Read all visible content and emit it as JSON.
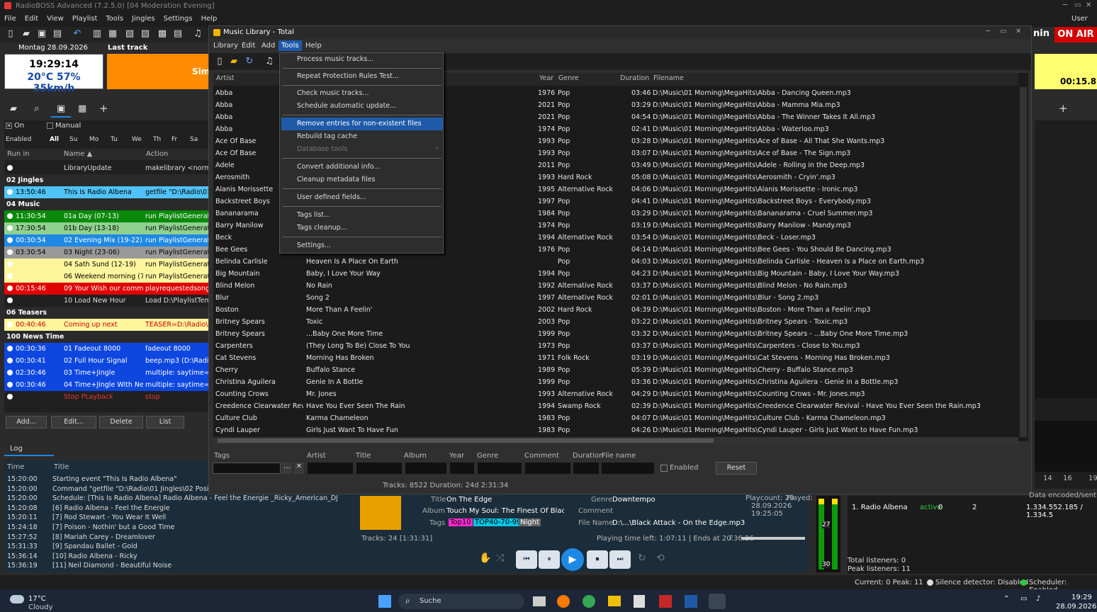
{
  "app": {
    "title": "RadioBOSS Advanced (7.2.5.0) [04 Moderation Evening]",
    "user": "User",
    "onair": "ON AIR",
    "min_label": "nin",
    "countdown": "00:15.8"
  },
  "menu": [
    "File",
    "Edit",
    "View",
    "Playlist",
    "Tools",
    "Jingles",
    "Settings",
    "Help"
  ],
  "header": {
    "date": "Montag 28.09.2026",
    "last_track_label": "Last track",
    "time": "19:29:14",
    "weather": "20°C 57% 35km/h",
    "sim": "Sim"
  },
  "scheduler": {
    "on_label": "On",
    "manual_label": "Manual",
    "days": [
      "Enabled",
      "All",
      "Su",
      "Mo",
      "Tu",
      "We",
      "Th",
      "Fr",
      "Sa"
    ],
    "columns": [
      "Run in",
      "Name ▲",
      "Action"
    ],
    "rows": [
      {
        "time": "",
        "name": "LibraryUpdate",
        "action": "makelibrary <norma",
        "bg": "#202020",
        "fg": "#ddd",
        "group": false
      },
      {
        "time": "",
        "name": "02 Jingles",
        "action": "",
        "bg": "#2a2a2a",
        "fg": "#fff",
        "group": true
      },
      {
        "time": "13:50:46",
        "name": "This Is Radio Albena",
        "action": "getfile \"D:\\Radio\\01",
        "bg": "#4fc3f7",
        "fg": "#000",
        "group": false
      },
      {
        "time": "",
        "name": "04 Music",
        "action": "",
        "bg": "#2a2a2a",
        "fg": "#fff",
        "group": true
      },
      {
        "time": "11:30:54",
        "name": "01a Day (07-13)",
        "action": "run PlaylistGenerato",
        "bg": "#0a8a0a",
        "fg": "#fff",
        "group": false
      },
      {
        "time": "17:30:54",
        "name": "01b Day (13-18)",
        "action": "run PlaylistGenerato",
        "bg": "#8fd18f",
        "fg": "#000",
        "group": false
      },
      {
        "time": "00:30:54",
        "name": "02 Evening Mix (19-22)",
        "action": "run PlaylistGenerato",
        "bg": "#1e88e5",
        "fg": "#fff",
        "group": false
      },
      {
        "time": "03:30:54",
        "name": "03 Night (23-06)",
        "action": "run PlaylistGenerato",
        "bg": "#999999",
        "fg": "#000",
        "group": false
      },
      {
        "time": "",
        "name": "04 Sath Sund (12-19)",
        "action": "run PlaylistGenerato",
        "bg": "#fff59d",
        "fg": "#000",
        "group": false
      },
      {
        "time": "",
        "name": "06 Weekend morning (7...",
        "action": "run PlaylistGenerato",
        "bg": "#fff59d",
        "fg": "#000",
        "group": false
      },
      {
        "time": "00:15:46",
        "name": "09 Your Wish our comm...",
        "action": "playrequestedsong",
        "bg": "#e00000",
        "fg": "#fff",
        "group": false
      },
      {
        "time": "",
        "name": "10 Load New Hour",
        "action": "Load D:\\PlaylistTemp",
        "bg": "#202020",
        "fg": "#ddd",
        "group": false
      },
      {
        "time": "",
        "name": "06 Teasers",
        "action": "",
        "bg": "#2a2a2a",
        "fg": "#fff",
        "group": true
      },
      {
        "time": "00:40:46",
        "name": "Coming up next",
        "action": "TEASER=D:\\Radio\\0",
        "bg": "#fff59d",
        "fg": "#d40000",
        "group": false
      },
      {
        "time": "",
        "name": "100 News Time",
        "action": "",
        "bg": "#2a2a2a",
        "fg": "#fff",
        "group": true
      },
      {
        "time": "00:30:36",
        "name": "01 Fadeout 8000",
        "action": "fadeout 8000",
        "bg": "#0d47e0",
        "fg": "#fff",
        "group": false
      },
      {
        "time": "00:30:41",
        "name": "02 Full Hour Signal",
        "action": "beep.mp3 (D:\\Radio\\",
        "bg": "#0d47e0",
        "fg": "#fff",
        "group": false
      },
      {
        "time": "02:30:46",
        "name": "03 Time+Jingle",
        "action": "multiple: saytime=D",
        "bg": "#0d47e0",
        "fg": "#fff",
        "group": false
      },
      {
        "time": "00:30:46",
        "name": "04 Time+Jingle With Ne...",
        "action": "multiple: saytime=D",
        "bg": "#0d47e0",
        "fg": "#fff",
        "group": false
      },
      {
        "time": "",
        "name": "Stop PLayback",
        "action": "stop",
        "bg": "#202020",
        "fg": "#e53935",
        "group": false
      }
    ],
    "buttons": [
      "Add...",
      "Edit...",
      "Delete",
      "List"
    ]
  },
  "log": {
    "tab": "Log",
    "columns": [
      "Time",
      "Title"
    ],
    "rows": [
      [
        "15:20:00",
        "Starting event \"This Is Radio Albena\""
      ],
      [
        "15:20:00",
        "Command \"getfile \"D:\\Radio\\01 Jingles\\02 Position"
      ],
      [
        "15:20:00",
        "Schedule: [This Is Radio Albena] Radio Albena - Feel the Energie _Ricky_American_DJ.mp3 (..."
      ],
      [
        "15:20:08",
        "[6]  Radio Albena - Feel the Energie"
      ],
      [
        "15:20:11",
        "[7]  Rod Stewart - You Wear It Well"
      ],
      [
        "15:24:18",
        "[7]  Poison - Nothin' but a Good Time"
      ],
      [
        "15:27:52",
        "[8]  Mariah Carey - Dreamlover"
      ],
      [
        "15:31:33",
        "[9]  Spandau Ballet - Gold"
      ],
      [
        "15:36:14",
        "[10]  Radio Albena - Ricky"
      ],
      [
        "15:36:19",
        "[11]  Neil Diamond - Beautiful Noise"
      ]
    ]
  },
  "library": {
    "title": "Music Library - Total",
    "menu": [
      "Library",
      "Edit",
      "Add",
      "Tools",
      "Help"
    ],
    "columns": [
      "Artist",
      "Year",
      "Genre",
      "Duration",
      "Filename"
    ],
    "rows": [
      [
        "Abba",
        "",
        "1976",
        "Pop",
        "03:46",
        "D:\\Music\\01 Morning\\MegaHits\\Abba - Dancing Queen.mp3"
      ],
      [
        "Abba",
        "",
        "2021",
        "Pop",
        "03:29",
        "D:\\Music\\01 Morning\\MegaHits\\Abba - Mamma Mia.mp3"
      ],
      [
        "Abba",
        "",
        "2021",
        "Pop",
        "04:54",
        "D:\\Music\\01 Morning\\MegaHits\\Abba - The Winner Takes It All.mp3"
      ],
      [
        "Abba",
        "",
        "1974",
        "Pop",
        "02:41",
        "D:\\Music\\01 Morning\\MegaHits\\Abba - Waterloo.mp3"
      ],
      [
        "Ace Of Base",
        "",
        "1993",
        "Pop",
        "03:28",
        "D:\\Music\\01 Morning\\MegaHits\\Ace of Base - All That She Wants.mp3"
      ],
      [
        "Ace Of Base",
        "",
        "1993",
        "Pop",
        "03:07",
        "D:\\Music\\01 Morning\\MegaHits\\Ace of Base - The Sign.mp3"
      ],
      [
        "Adele",
        "",
        "2011",
        "Pop",
        "03:49",
        "D:\\Music\\01 Morning\\MegaHits\\Adele - Rolling in the Deep.mp3"
      ],
      [
        "Aerosmith",
        "",
        "1993",
        "Hard Rock",
        "05:08",
        "D:\\Music\\01 Morning\\MegaHits\\Aerosmith - Cryin'.mp3"
      ],
      [
        "Alanis Morissette",
        "",
        "1995",
        "Alternative Rock",
        "04:06",
        "D:\\Music\\01 Morning\\MegaHits\\Alanis Morissette - Ironic.mp3"
      ],
      [
        "Backstreet Boys",
        "on)",
        "1997",
        "Pop",
        "04:41",
        "D:\\Music\\01 Morning\\MegaHits\\Backstreet Boys - Everybody.mp3"
      ],
      [
        "Bananarama",
        "",
        "1984",
        "Pop",
        "03:29",
        "D:\\Music\\01 Morning\\MegaHits\\Bananarama - Cruel Summer.mp3"
      ],
      [
        "Barry Manilow",
        "",
        "1974",
        "Pop",
        "03:19",
        "D:\\Music\\01 Morning\\MegaHits\\Barry Manilow - Mandy.mp3"
      ],
      [
        "Beck",
        "",
        "1994",
        "Alternative Rock",
        "03:54",
        "D:\\Music\\01 Morning\\MegaHits\\Beck - Loser.mp3"
      ],
      [
        "Bee Gees",
        "",
        "1976",
        "Pop",
        "04:14",
        "D:\\Music\\01 Morning\\MegaHits\\Bee Gees - You Should Be Dancing.mp3"
      ],
      [
        "Belinda Carlisle",
        "Heaven Is A Place On Earth",
        "",
        "Pop",
        "04:03",
        "D:\\Music\\01 Morning\\MegaHits\\Belinda Carlisle - Heaven Is a Place on Earth.mp3"
      ],
      [
        "Big Mountain",
        "Baby, I Love Your Way",
        "1994",
        "Pop",
        "04:23",
        "D:\\Music\\01 Morning\\MegaHits\\Big Mountain - Baby, I Love Your Way.mp3"
      ],
      [
        "Blind Melon",
        "No Rain",
        "1992",
        "Alternative Rock",
        "03:37",
        "D:\\Music\\01 Morning\\MegaHits\\Blind Melon - No Rain.mp3"
      ],
      [
        "Blur",
        "Song 2",
        "1997",
        "Alternative Rock",
        "02:01",
        "D:\\Music\\01 Morning\\MegaHits\\Blur - Song 2.mp3"
      ],
      [
        "Boston",
        "More Than A Feelin'",
        "2002",
        "Hard Rock",
        "04:39",
        "D:\\Music\\01 Morning\\MegaHits\\Boston - More Than a Feelin'.mp3"
      ],
      [
        "Britney Spears",
        "Toxic",
        "2003",
        "Pop",
        "03:22",
        "D:\\Music\\01 Morning\\MegaHits\\Britney Spears - Toxic.mp3"
      ],
      [
        "Britney Spears",
        "...Baby One More Time",
        "1999",
        "Pop",
        "03:32",
        "D:\\Music\\01 Morning\\MegaHits\\Britney Spears - ...Baby One More Time.mp3"
      ],
      [
        "Carpenters",
        "(They Long To Be) Close To You",
        "1973",
        "Pop",
        "03:37",
        "D:\\Music\\01 Morning\\MegaHits\\Carpenters - Close to You.mp3"
      ],
      [
        "Cat Stevens",
        "Morning Has Broken",
        "1971",
        "Folk Rock",
        "03:19",
        "D:\\Music\\01 Morning\\MegaHits\\Cat Stevens - Morning Has Broken.mp3"
      ],
      [
        "Cherry",
        "Buffalo Stance",
        "1989",
        "Pop",
        "05:39",
        "D:\\Music\\01 Morning\\MegaHits\\Cherry - Buffalo Stance.mp3"
      ],
      [
        "Christina Aguilera",
        "Genie In A Bottle",
        "1999",
        "Pop",
        "03:36",
        "D:\\Music\\01 Morning\\MegaHits\\Christina Aguilera - Genie in a Bottle.mp3"
      ],
      [
        "Counting Crows",
        "Mr. Jones",
        "1993",
        "Alternative Rock",
        "04:29",
        "D:\\Music\\01 Morning\\MegaHits\\Counting Crows - Mr. Jones.mp3"
      ],
      [
        "Creedence Clearwater Revi...",
        "Have You Ever Seen The Rain",
        "1994",
        "Swamp Rock",
        "02:39",
        "D:\\Music\\01 Morning\\MegaHits\\Creedence Clearwater Revival - Have You Ever Seen the Rain.mp3"
      ],
      [
        "Culture Club",
        "Karma Chameleon",
        "1983",
        "Pop",
        "04:07",
        "D:\\Music\\01 Morning\\MegaHits\\Culture Club - Karma Chameleon.mp3"
      ],
      [
        "Cyndi Lauper",
        "Girls Just Want To Have Fun",
        "1983",
        "Pop",
        "04:26",
        "D:\\Music\\01 Morning\\MegaHits\\Cyndi Lauper - Girls Just Want to Have Fun.mp3"
      ]
    ],
    "filter_labels": [
      "Tags",
      "Artist",
      "Title",
      "Album",
      "Year",
      "Genre",
      "Comment",
      "Duration",
      "File name"
    ],
    "enabled_label": "Enabled",
    "reset_label": "Reset",
    "status": "Tracks: 8522 Duration: 24d 2:31:34"
  },
  "tools_menu": [
    {
      "label": "Process music tracks...",
      "disabled": false
    },
    {
      "label": "Repeat Protection Rules Test...",
      "disabled": false
    },
    {
      "label": "Check music tracks...",
      "disabled": false
    },
    {
      "label": "Schedule automatic update...",
      "disabled": false
    },
    {
      "label": "Remove entries for non-existent files",
      "disabled": false
    },
    {
      "label": "Rebuild tag cache",
      "disabled": false
    },
    {
      "label": "Database tools",
      "disabled": true
    },
    {
      "label": "Convert additional info...",
      "disabled": false
    },
    {
      "label": "Cleanup metadata files",
      "disabled": false
    },
    {
      "label": "User defined fields...",
      "disabled": false
    },
    {
      "label": "Tags list...",
      "disabled": false
    },
    {
      "label": "Tags cleanup...",
      "disabled": false
    },
    {
      "label": "Settings...",
      "disabled": false
    }
  ],
  "player": {
    "title_label": "Title",
    "title": "On The Edge",
    "album_label": "Album",
    "album": "Touch My Soul: The Finest Of Black Mu",
    "tags_label": "Tags",
    "tags": [
      "Top10",
      "TOP40-70-99",
      "Night"
    ],
    "genre_label": "Genre",
    "genre": "Downtempo",
    "comment_label": "Comment",
    "filename_label": "File Name",
    "filename": "D:\\...\\Black Attack - On the Edge.mp3",
    "playcount": "Playcount: 20",
    "played": "Played:",
    "played_at": "28.09.2026 19:25:05",
    "tracks": "Tracks: 24 [1:31:31]",
    "time_left": "Playing time left: 1:07:11 | Ends at 20:36:26"
  },
  "vu": {
    "level1": "27",
    "level2": "30"
  },
  "stream": {
    "col": "Data encoded/sent",
    "name": "1. Radio Albena",
    "state": "active",
    "v1": "0",
    "v2": "2",
    "data": "1.334.552.185 / 1.334.5",
    "total": "Total listeners: 0",
    "peak": "Peak listeners: 11",
    "axis": [
      "14",
      "16",
      "19"
    ]
  },
  "statusbar": {
    "current": "Current: 0  Peak: 11",
    "silence": "Silence detector: Disabled",
    "scheduler": "Scheduler: Enabled"
  },
  "taskbar": {
    "temp": "17°C",
    "weather": "Cloudy",
    "search": "Suche",
    "time": "19:29",
    "date": "28.09.2026"
  }
}
